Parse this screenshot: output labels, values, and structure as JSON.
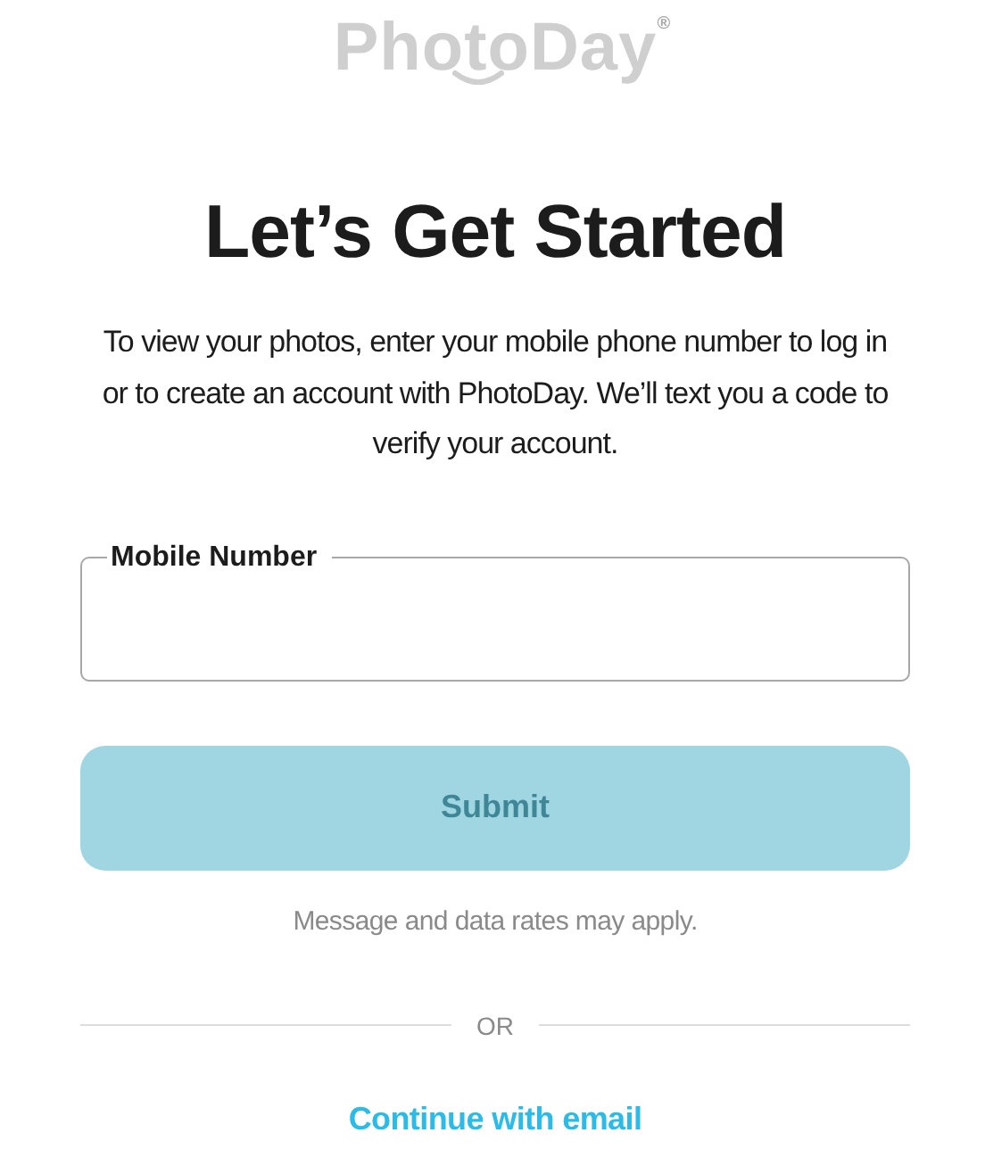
{
  "logo": {
    "text": "PhotoDay",
    "mark": "®"
  },
  "title": "Let’s Get Started",
  "intro": "To view your photos, enter your mobile phone number to log in or to create an account with PhotoDay. We’ll text you a code to verify your account.",
  "phone_field": {
    "label": "Mobile Number"
  },
  "submit_button": {
    "label": "Submit",
    "disabled": true
  },
  "note": "Message and data rates may apply.",
  "divider": "OR",
  "email_link": "Continue with email"
}
